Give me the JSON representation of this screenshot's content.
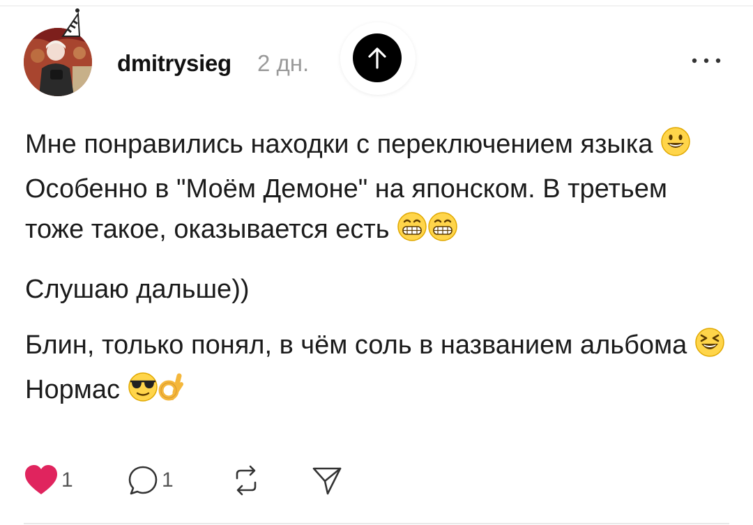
{
  "post": {
    "author": {
      "username": "dmitrysieg",
      "avatar": "avatar-photo",
      "badge": "party-hat-icon"
    },
    "time": "2 дн.",
    "paragraphs": [
      {
        "segments": [
          "Мне понравились находки с переключением языка",
          "Особенно в \"Моём Демоне\" на японском. В третьем тоже такое, оказывается есть"
        ],
        "emojis": [
          "smiley-emoji",
          "grin-emoji",
          "grin-emoji"
        ]
      },
      {
        "segments": [
          "Слушаю дальше))"
        ],
        "emojis": []
      },
      {
        "segments": [
          "Блин, только понял, в чём соль в названием альбома",
          "Нормас"
        ],
        "emojis": [
          "laughing-emoji",
          "sunglasses-emoji",
          "ok-hand-emoji"
        ]
      }
    ]
  },
  "actions": {
    "likes": "1",
    "comments": "1",
    "repost_icon": "repost-icon",
    "share_icon": "share-icon",
    "like_icon": "heart-icon",
    "comment_icon": "comment-icon"
  },
  "controls": {
    "scroll_top_icon": "arrow-up-icon",
    "more_icon": "more-icon"
  },
  "colors": {
    "heart": "#e0245e",
    "muted": "#9a9a9a",
    "emoji": "#ffd54a"
  }
}
